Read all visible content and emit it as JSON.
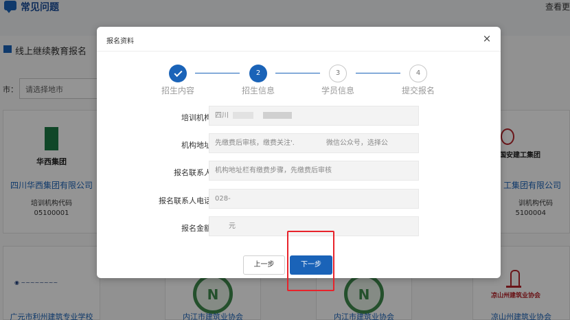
{
  "background": {
    "header_title": "常见问题",
    "header_more": "查看更",
    "section_title": "线上继续教育报名",
    "city_label": "市：",
    "city_placeholder": "请选择地市",
    "cards": [
      {
        "logo_text": "华西集团",
        "name": "四川华西集团有限公司",
        "code_label": "培训机构代码",
        "code_value": "05100001"
      },
      {
        "logo_text": "国安建工集团",
        "name": "工集团有限公司",
        "code_label": "训机构代码",
        "code_value": "5100004"
      }
    ],
    "bottom_cards": [
      {
        "name": "广元市利州建筑专业学校"
      },
      {
        "name": "内江市建筑业协会"
      },
      {
        "name": "内江市建筑业协会"
      },
      {
        "name": "凉山州建筑业协会",
        "logo_text": "凉山州建筑业协会"
      }
    ]
  },
  "modal": {
    "title": "报名资料",
    "close_glyph": "×",
    "steps": [
      {
        "number": "",
        "label": "招生内容",
        "state": "done"
      },
      {
        "number": "2",
        "label": "招生信息",
        "state": "active"
      },
      {
        "number": "3",
        "label": "学员信息",
        "state": "todo"
      },
      {
        "number": "4",
        "label": "提交报名",
        "state": "todo"
      }
    ],
    "fields": [
      {
        "label": "培训机构：",
        "value": "四川"
      },
      {
        "label": "机构地址：",
        "value": "先缴费后审核，缴费关注'.",
        "value_tail": "微信公众号，选择公"
      },
      {
        "label": "报名联系人：",
        "value": "机构地址栏有缴费步骤，先缴费后审核"
      },
      {
        "label": "报名联系人电话：",
        "value": "028-"
      },
      {
        "label": "报名金额：",
        "value": "元"
      }
    ],
    "prev_label": "上一步",
    "next_label": "下一步"
  }
}
